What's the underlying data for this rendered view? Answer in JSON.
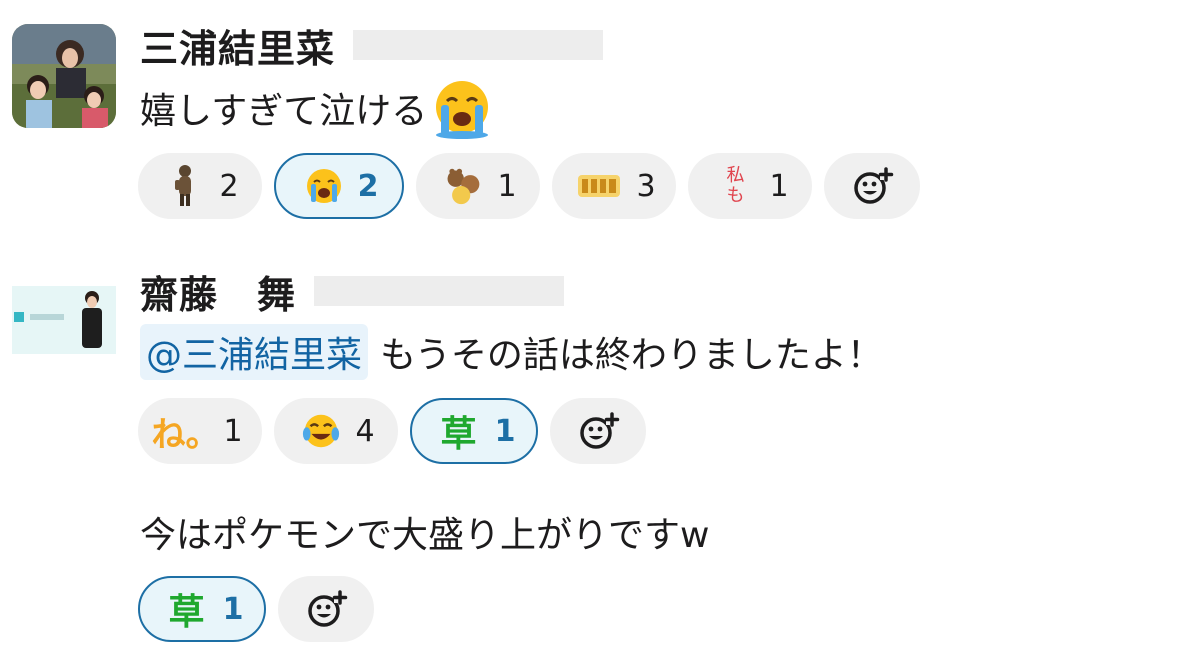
{
  "messages": [
    {
      "author": "三浦結里菜",
      "text": "嬉しすぎて泣ける",
      "reactions": [
        {
          "emoji": "bear-standing-sticker",
          "count": "2",
          "active": false
        },
        {
          "emoji": "loudly-crying-face",
          "count": "2",
          "active": true
        },
        {
          "emoji": "bears-sticker",
          "count": "1",
          "active": false
        },
        {
          "emoji": "omedeto-text-sticker",
          "count": "3",
          "active": false
        },
        {
          "emoji": "watashi-mo-text",
          "text": "私も",
          "count": "1",
          "active": false
        }
      ]
    },
    {
      "author": "齋藤　舞",
      "mention": "@三浦結里菜",
      "text": "もうその話は終わりましたよ！",
      "reactions": [
        {
          "emoji": "ne-text",
          "text": "ね。",
          "count": "1",
          "active": false
        },
        {
          "emoji": "face-with-tears-of-joy",
          "count": "4",
          "active": false
        },
        {
          "emoji": "kusa-text",
          "text": "草",
          "count": "1",
          "active": true
        }
      ]
    },
    {
      "text": "今はポケモンで大盛り上がりですw",
      "reactions": [
        {
          "emoji": "kusa-text",
          "text": "草",
          "count": "1",
          "active": true
        }
      ]
    }
  ],
  "colors": {
    "active_border": "#1d6fa5",
    "active_bg": "#e8f5fa",
    "chip_bg": "#f0f0f0",
    "mention_bg": "#e8f3fb",
    "mention_text": "#1264a3",
    "kusa_green": "#1fa82e"
  },
  "icons": {
    "add_reaction": "add-reaction-icon"
  }
}
